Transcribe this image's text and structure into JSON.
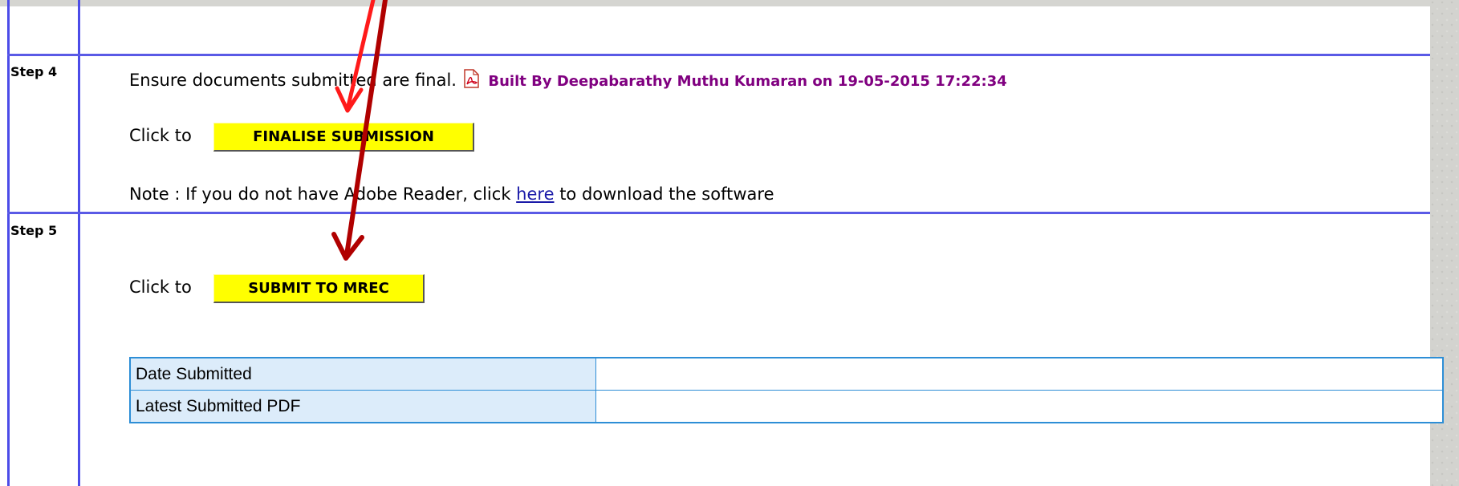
{
  "steps": [
    {
      "label": "Step 4"
    },
    {
      "label": "Step 5"
    }
  ],
  "step4": {
    "instruction": "Ensure documents submitted are final.",
    "pdf_icon": "pdf-icon",
    "built_by": "Built By Deepabarathy Muthu Kumaran on 19-05-2015 17:22:34",
    "click_to": "Click to",
    "finalise_button": "FINALISE SUBMISSION",
    "note_prefix": "Note : If you do not have Adobe Reader, click",
    "note_link": "here",
    "note_suffix": "to download the software"
  },
  "step5": {
    "click_to": "Click to",
    "submit_button": "SUBMIT TO MREC",
    "table": [
      {
        "label": "Date Submitted",
        "value": ""
      },
      {
        "label": "Latest Submitted PDF",
        "value": ""
      }
    ]
  },
  "colors": {
    "button": "#ffff00",
    "grid_lines": "#4c4ce8",
    "built_by": "#800080",
    "arrow_light": "#ff1a1a",
    "arrow_dark": "#b00000"
  }
}
